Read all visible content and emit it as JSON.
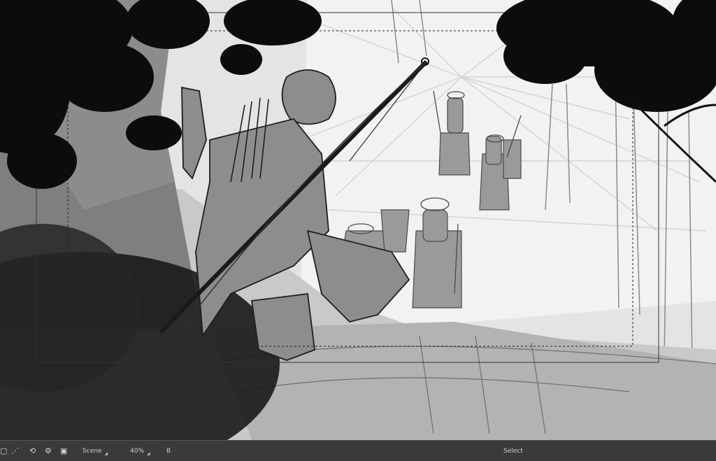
{
  "canvas": {
    "description_name": "storyboard-sketch"
  },
  "statusbar": {
    "icons": [
      "frame-icon",
      "onion-skin-icon",
      "rotate-view-icon",
      "flip-icon",
      "camera-icon"
    ],
    "scene_label": "Scene",
    "zoom_value": "40%",
    "layer_label": "B",
    "tool_label": "Select"
  }
}
